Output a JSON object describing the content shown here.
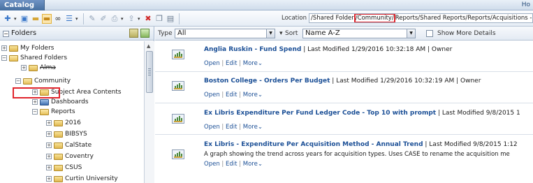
{
  "window": {
    "tab_title": "Catalog",
    "right_text": "Ho"
  },
  "toolbar": {
    "location_label": "Location",
    "location_parts": {
      "before": "/Shared Folder",
      "highlighted": "/Community/",
      "after": "Reports/Shared Reports/Reports/Acquisitions - Expe"
    },
    "icons": [
      "new-icon",
      "open-icon",
      "folder-icon",
      "folder-highlight-icon",
      "binoculars-icon",
      "view-list-icon",
      "edit-icon",
      "pencil-icon",
      "print-icon",
      "share-icon",
      "delete-icon",
      "copy-icon",
      "paste-icon"
    ]
  },
  "folders_pane": {
    "title": "Folders",
    "tree": [
      {
        "label": "My Folders",
        "expander": "+"
      },
      {
        "label": "Shared Folders",
        "expander": "−"
      },
      {
        "label": "Alma",
        "expander": "+"
      },
      {
        "label": "Community",
        "expander": "−",
        "highlighted": true
      },
      {
        "label": "Subject Area Contents",
        "expander": "+"
      },
      {
        "label": "Dashboards",
        "expander": "+"
      },
      {
        "label": "Reports",
        "expander": "−"
      },
      {
        "label": "2016",
        "expander": "+"
      },
      {
        "label": "BIBSYS",
        "expander": "+"
      },
      {
        "label": "CalState",
        "expander": "+"
      },
      {
        "label": "Coventry",
        "expander": "+"
      },
      {
        "label": "CSUS",
        "expander": "+"
      },
      {
        "label": "Curtin University",
        "expander": "+"
      }
    ]
  },
  "filter_bar": {
    "type_label": "Type",
    "type_value": "All",
    "sort_label": "Sort",
    "sort_value": "Name A-Z",
    "show_more_label": "Show More Details",
    "show_more_checked": false
  },
  "items": [
    {
      "name": "Anglia Ruskin - Fund Spend",
      "meta": " | Last Modified 1/29/2016 10:32:18 AM | Owner",
      "description": "",
      "actions": {
        "open": "Open",
        "edit": "Edit",
        "more": "More"
      }
    },
    {
      "name": "Boston College - Orders Per Budget",
      "meta": " | Last Modified 1/29/2016 10:32:19 AM | Owner",
      "description": "",
      "actions": {
        "open": "Open",
        "edit": "Edit",
        "more": "More"
      }
    },
    {
      "name": "Ex Libris Expenditure Per Fund Ledger Code - Top 10 with prompt",
      "meta": " | Last Modified 9/8/2015 1",
      "description": "",
      "actions": {
        "open": "Open",
        "edit": "Edit",
        "more": "More"
      }
    },
    {
      "name": "Ex Libris - Expenditure Per Acquisition Method - Annual Trend",
      "meta": " | Last Modified 9/8/2015 1:12",
      "description": "A graph showing the trend across years for acquisition types. Uses CASE to rename the acquisition me",
      "actions": {
        "open": "Open",
        "edit": "Edit",
        "more": "More"
      }
    }
  ],
  "colors": {
    "highlight_red": "#e0242c",
    "link_blue": "#1b4f96",
    "header_blue": "#466f9f"
  }
}
